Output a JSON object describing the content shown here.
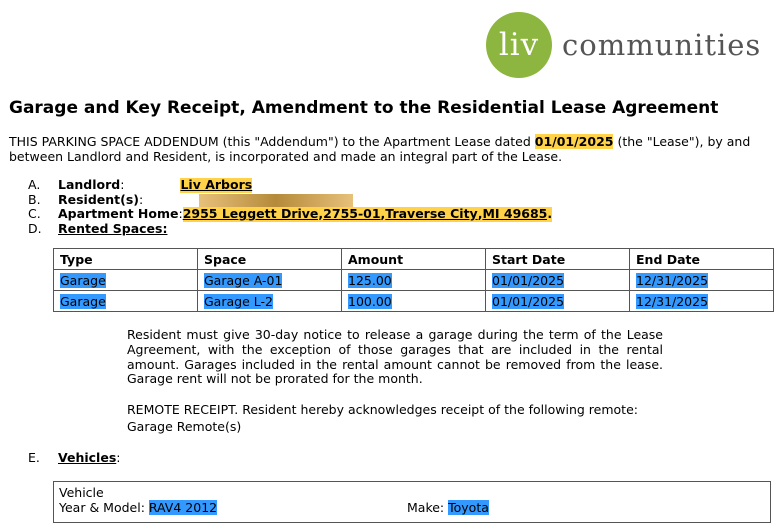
{
  "logo": {
    "mark": "liv",
    "word": "communities"
  },
  "title": "Garage and Key Receipt, Amendment to the Residential Lease Agreement",
  "intro": {
    "part1": "THIS PARKING SPACE ADDENDUM (this \"Addendum\") to the Apartment Lease dated ",
    "date": "01/01/2025",
    "part2": " (the \"Lease\"), by and between Landlord and Resident, is incorporated and made an integral part of the Lease."
  },
  "items": {
    "a": {
      "letter": "A.",
      "label": "Landlord",
      "colon": ":",
      "value": "Liv Arbors"
    },
    "b": {
      "letter": "B.",
      "label": "Resident(s)",
      "colon": ":"
    },
    "c": {
      "letter": "C.",
      "label": "Apartment Home",
      "colon": ":",
      "street": "2955 Leggett Drive",
      "unit": "2755-01",
      "city": "Traverse City",
      "state_zip": "MI 49685",
      "sep": ", ",
      "end": "."
    },
    "d": {
      "letter": "D.",
      "label": "Rented Spaces:"
    }
  },
  "table": {
    "headers": [
      "Type",
      "Space",
      "Amount",
      "Start Date",
      "End Date"
    ],
    "rows": [
      [
        "Garage",
        "Garage A-01",
        "125.00",
        "01/01/2025",
        "12/31/2025"
      ],
      [
        "Garage",
        "Garage L-2",
        "100.00",
        "01/01/2025",
        "12/31/2025"
      ]
    ]
  },
  "notice": "Resident must give 30-day notice to release a garage during the term of the Lease Agreement, with the exception of those garages that are included in the rental amount. Garages included in the rental amount cannot be removed from the lease. Garage rent will not be prorated for the month.",
  "remote": {
    "line1": "REMOTE RECEIPT.  Resident hereby acknowledges receipt of the following remote:",
    "line2": "Garage Remote(s)"
  },
  "vehicles": {
    "letter": "E.",
    "label": "Vehicles",
    "colon": ":",
    "box_title": "Vehicle",
    "year_model_label": "Year & Model: ",
    "year_model": "RAV4 2012",
    "make_label": "Make: ",
    "make": "Toyota"
  }
}
